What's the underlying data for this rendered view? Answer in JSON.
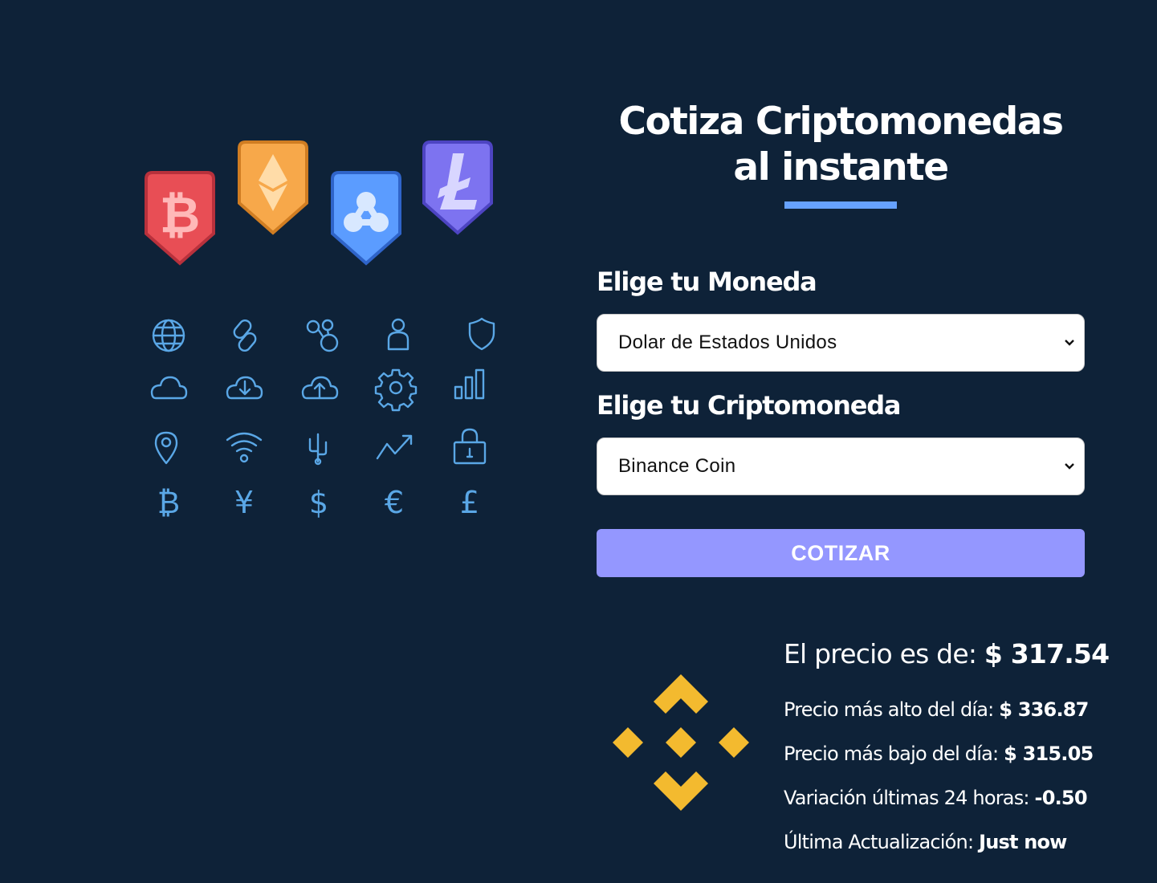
{
  "page": {
    "title": "Cotiza Criptomonedas al instante",
    "accent_color": "#66a2fe",
    "background_color": "#0e2238"
  },
  "form": {
    "currency_label": "Elige tu Moneda",
    "currency_selected": "Dolar de Estados Unidos",
    "crypto_label": "Elige tu Criptomoneda",
    "crypto_selected": "Binance Coin",
    "submit_label": "COTIZAR",
    "submit_color": "#9497ff"
  },
  "result": {
    "price_label": "El precio es de:",
    "price_value": "$ 317.54",
    "high_label": "Precio más alto del día:",
    "high_value": "$ 336.87",
    "low_label": "Precio más bajo del día:",
    "low_value": "$ 315.05",
    "change_label": "Variación últimas 24 horas:",
    "change_value": "-0.50",
    "updated_label": "Última Actualización:",
    "updated_value": "Just now",
    "coin_icon": "binance-coin-logo",
    "coin_color": "#f3ba2f"
  },
  "hero": {
    "badges": [
      "bitcoin-badge",
      "ethereum-badge",
      "ripple-badge",
      "litecoin-badge"
    ],
    "icons": [
      "globe-icon",
      "link-icon",
      "network-icon",
      "user-icon",
      "shield-icon",
      "cloud-icon",
      "cloud-download-icon",
      "cloud-upload-icon",
      "gear-icon",
      "bar-chart-icon",
      "location-pin-icon",
      "wifi-icon",
      "usb-icon",
      "trend-up-icon",
      "lock-icon",
      "bitcoin-symbol-icon",
      "yen-icon",
      "dollar-icon",
      "euro-icon",
      "pound-icon"
    ],
    "icon_color": "#5aa7e6"
  }
}
